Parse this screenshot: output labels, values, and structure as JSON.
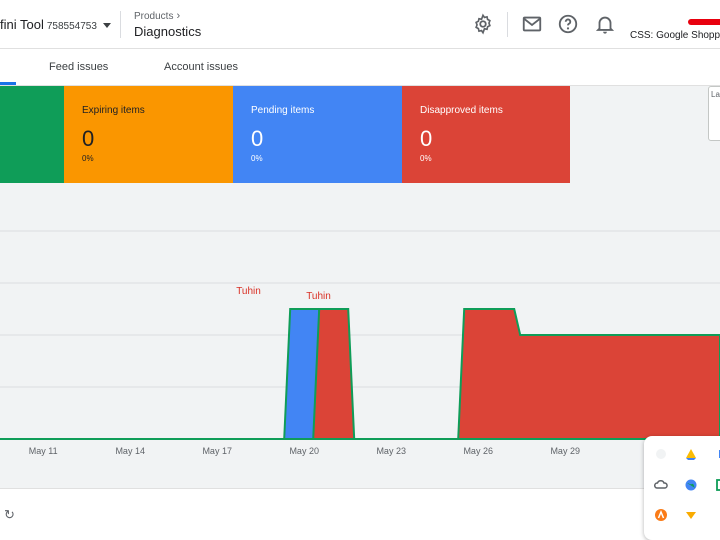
{
  "header": {
    "account_name": "fini Tool",
    "account_id": "758554753",
    "breadcrumb": "Products",
    "page_title": "Diagnostics",
    "css_label": "CSS: Google Shopping"
  },
  "tabs": [
    {
      "label": "Feed issues"
    },
    {
      "label": "Account issues"
    }
  ],
  "cards": [
    {
      "label": "",
      "value": "",
      "percent": "",
      "color": "#0f9d58"
    },
    {
      "label": "Expiring items",
      "value": "0",
      "percent": "0%",
      "color": "#fa9600"
    },
    {
      "label": "Pending items",
      "value": "0",
      "percent": "0%",
      "color": "#4285f4"
    },
    {
      "label": "Disapproved items",
      "value": "0",
      "percent": "0%",
      "color": "#db4437"
    }
  ],
  "right_box": {
    "label": "Las"
  },
  "chart_data": {
    "type": "area",
    "x_tick_labels": [
      "May 11",
      "May 14",
      "May 17",
      "May 20",
      "May 23",
      "May 26",
      "May 29"
    ],
    "x": [
      "May 8",
      "May 9",
      "May 10",
      "May 11",
      "May 12",
      "May 13",
      "May 14",
      "May 15",
      "May 16",
      "May 17",
      "May 18",
      "May 19",
      "May 20",
      "May 21",
      "May 22",
      "May 23",
      "May 24",
      "May 25",
      "May 26",
      "May 27",
      "May 28",
      "May 29",
      "May 30",
      "May 31",
      "Jun 1"
    ],
    "series": [
      {
        "color": "#0f9d58",
        "values": [
          0,
          0,
          0,
          0,
          0,
          0,
          0,
          0,
          0,
          0,
          0,
          0,
          0,
          0,
          0,
          0,
          0,
          0,
          0,
          0,
          0,
          0,
          0,
          0,
          0
        ]
      },
      {
        "color": "#4285f4",
        "values": [
          0,
          0,
          0,
          0,
          0,
          0,
          0,
          0,
          0,
          0,
          0,
          0,
          2.5,
          0,
          0,
          0,
          0,
          0,
          0,
          0,
          0,
          0,
          0,
          0,
          0
        ]
      },
      {
        "color": "#db4437",
        "values": [
          0,
          0,
          0,
          0,
          0,
          0,
          0,
          0,
          0,
          0,
          0,
          0,
          0,
          2.5,
          0,
          0,
          0,
          0,
          2.5,
          2.5,
          2,
          2,
          2,
          2,
          2
        ]
      }
    ],
    "annotations": [
      {
        "text": "Tuhin",
        "x": "May 18",
        "y": 3.1
      },
      {
        "text": "Tuhin",
        "x": "May 20",
        "y": 3.0
      }
    ],
    "ylim": [
      0,
      4
    ],
    "grid": true,
    "annotation_color": "#d93025"
  },
  "icons": {
    "settings": "gear-icon",
    "mail": "mail-icon",
    "help": "help-icon",
    "notifications": "bell-icon",
    "refresh": "refresh-icon"
  },
  "refresh_glyph": "↻"
}
